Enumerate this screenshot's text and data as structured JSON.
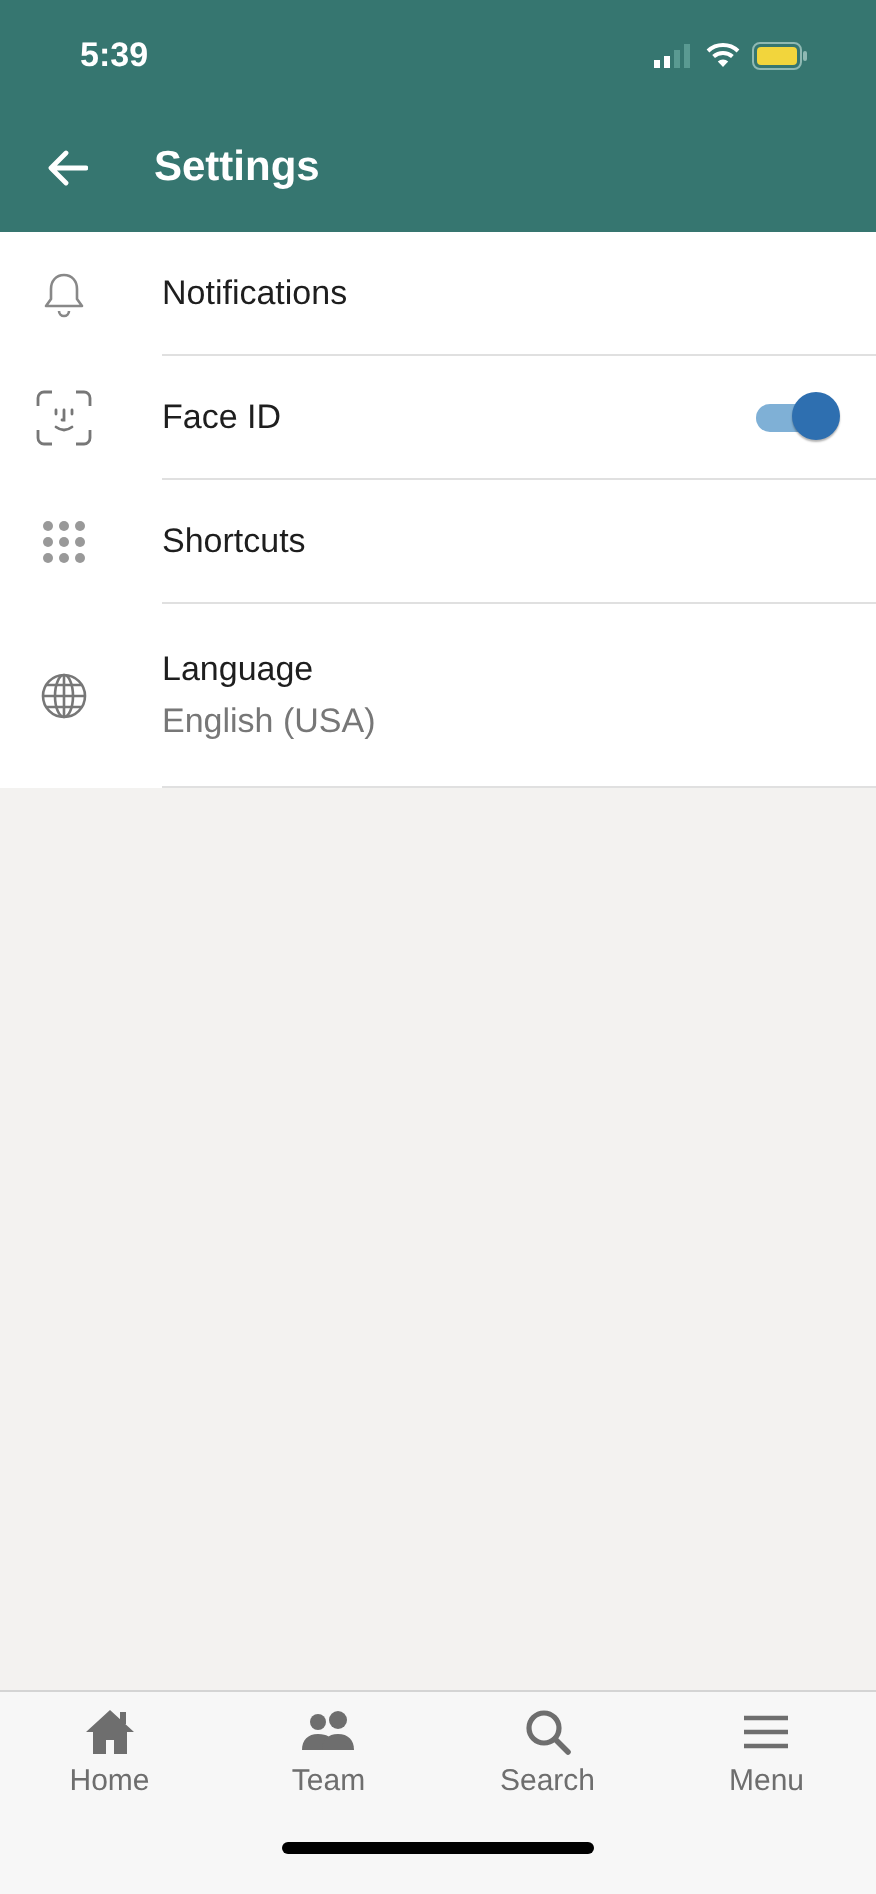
{
  "status_bar": {
    "time": "5:39"
  },
  "header": {
    "title": "Settings"
  },
  "settings": [
    {
      "kind": "plain",
      "label": "Notifications"
    },
    {
      "kind": "toggle",
      "label": "Face ID",
      "on": true
    },
    {
      "kind": "plain",
      "label": "Shortcuts"
    },
    {
      "kind": "value",
      "label": "Language",
      "value": "English (USA)"
    }
  ],
  "tab_bar": [
    {
      "label": "Home"
    },
    {
      "label": "Team"
    },
    {
      "label": "Search"
    },
    {
      "label": "Menu"
    }
  ]
}
